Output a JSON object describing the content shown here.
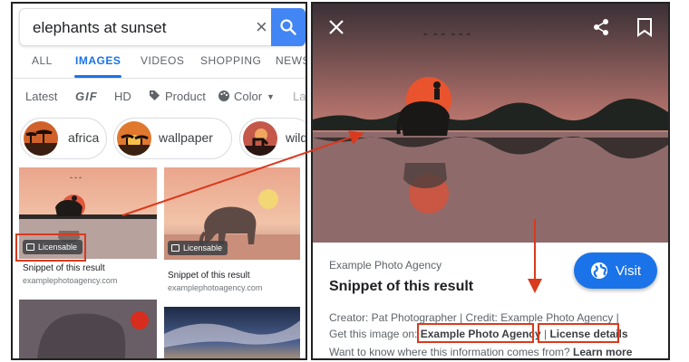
{
  "search": {
    "query": "elephants at sunset"
  },
  "tabs": [
    "ALL",
    "IMAGES",
    "VIDEOS",
    "SHOPPING",
    "NEWS"
  ],
  "filters": {
    "latest": "Latest",
    "gif": "GIF",
    "hd": "HD",
    "product": "Product",
    "color": "Color",
    "more": "La"
  },
  "chips": [
    "africa",
    "wallpaper",
    "wild"
  ],
  "results": [
    {
      "badge": "Licensable",
      "title": "Snippet of this result",
      "site": "examplephotoagency.com"
    },
    {
      "badge": "Licensable",
      "title": "Snippet of this result",
      "site": "examplephotoagency.com"
    }
  ],
  "detail": {
    "agency": "Example Photo Agency",
    "title": "Snippet of this result",
    "visit_label": "Visit",
    "credit_line": "Creator: Pat Photographer | Credit: Example Photo Agency |",
    "get_prefix": "Get this image on:",
    "get_link": "Example Photo Agency",
    "separator": "|",
    "license_link": "License details",
    "learn_prefix": "Want to know where this information comes from?",
    "learn_link": "Learn more"
  },
  "colors": {
    "accent": "#1a73e8",
    "annotation": "#d93a1e",
    "search_button": "#4285f4"
  }
}
